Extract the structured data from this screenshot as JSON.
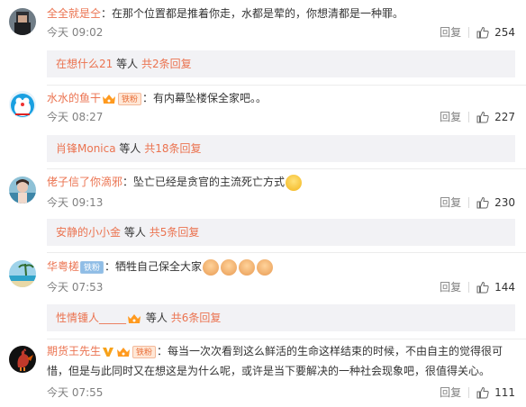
{
  "comments": [
    {
      "username": "全全就是仝",
      "text": "在那个位置都是推着你走，水都是荤的，你想清都是一种罪。",
      "time": "今天 09:02",
      "reply_label": "回复",
      "likes": "254",
      "sub_reply": {
        "user": "在想什么21",
        "etc": "等人",
        "total": "共2条回复"
      }
    },
    {
      "username": "水水的鱼干",
      "badge": "铁粉",
      "text": "有内幕坠楼保全家吧。。",
      "time": "今天 08:27",
      "reply_label": "回复",
      "likes": "227",
      "sub_reply": {
        "user": "肖锋Monica",
        "etc": "等人",
        "total": "共18条回复"
      }
    },
    {
      "username": "佬子信了你滴邪",
      "text": "坠亡已经是贪官的主流死亡方式",
      "time": "今天 09:13",
      "reply_label": "回复",
      "likes": "230",
      "sub_reply": {
        "user": "安静的小小金",
        "etc": "等人",
        "total": "共5条回复"
      }
    },
    {
      "username": "华粤槎",
      "badge": "铁粉",
      "text": "牺牲自己保全大家",
      "time": "今天 07:53",
      "reply_label": "回复",
      "likes": "144",
      "sub_reply": {
        "user": "性情锺人_____",
        "etc": "等人",
        "total": "共6条回复"
      }
    },
    {
      "username": "期货王先生",
      "badge": "铁粉",
      "text": "每当一次次看到这么鲜活的生命这样结束的时候，不由自主的觉得很可惜，但是与此同时又在想这是为什么呢，或许是当下要解决的一种社会现象吧，很值得关心。",
      "time": "今天 07:55",
      "reply_label": "回复",
      "likes": "111"
    }
  ],
  "colors": {
    "username": "#eb7350",
    "meta": "#808080",
    "sub_bg": "#f2f2f5"
  }
}
